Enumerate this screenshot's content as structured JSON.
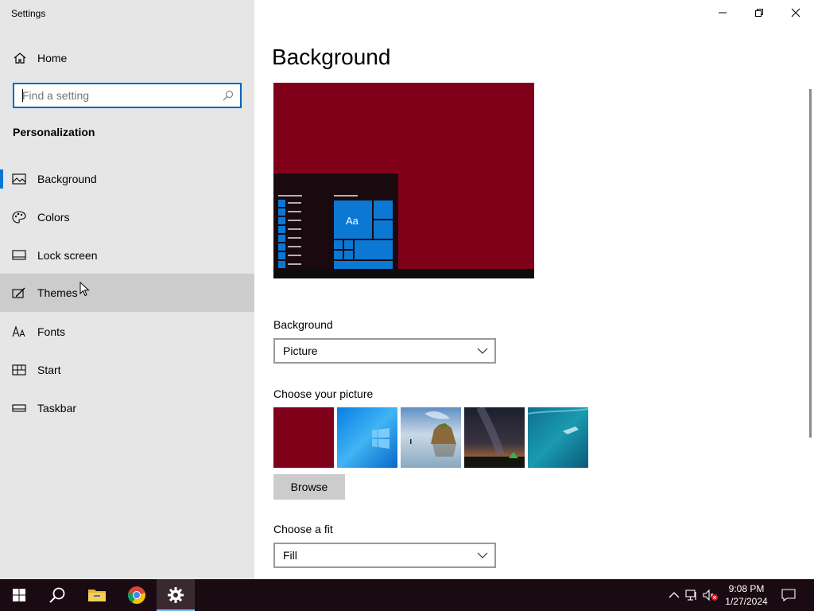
{
  "window": {
    "title": "Settings",
    "controls": {
      "minimize": "minimize-icon",
      "restore": "restore-icon",
      "close": "close-icon"
    }
  },
  "sidebar": {
    "home_label": "Home",
    "search_placeholder": "Find a setting",
    "section_title": "Personalization",
    "items": [
      {
        "label": "Background",
        "icon": "picture-icon",
        "active": true
      },
      {
        "label": "Colors",
        "icon": "palette-icon"
      },
      {
        "label": "Lock screen",
        "icon": "lock-screen-icon"
      },
      {
        "label": "Themes",
        "icon": "themes-icon",
        "hover": true
      },
      {
        "label": "Fonts",
        "icon": "fonts-icon"
      },
      {
        "label": "Start",
        "icon": "start-icon"
      },
      {
        "label": "Taskbar",
        "icon": "taskbar-icon"
      }
    ]
  },
  "main": {
    "title": "Background",
    "preview_tile_text": "Aa",
    "background_label": "Background",
    "background_value": "Picture",
    "choose_picture_label": "Choose your picture",
    "browse_label": "Browse",
    "fit_label": "Choose a fit",
    "fit_value": "Fill"
  },
  "taskbar": {
    "apps": [
      "start-icon",
      "search-icon",
      "file-explorer-icon",
      "chrome-icon",
      "settings-icon"
    ],
    "time": "9:08 PM",
    "date": "1/27/2024"
  },
  "colors": {
    "accent": "#0078d7",
    "wallpaper": "#800019",
    "tile_blue": "#0b78d4",
    "taskbar": "#1a0b12"
  }
}
